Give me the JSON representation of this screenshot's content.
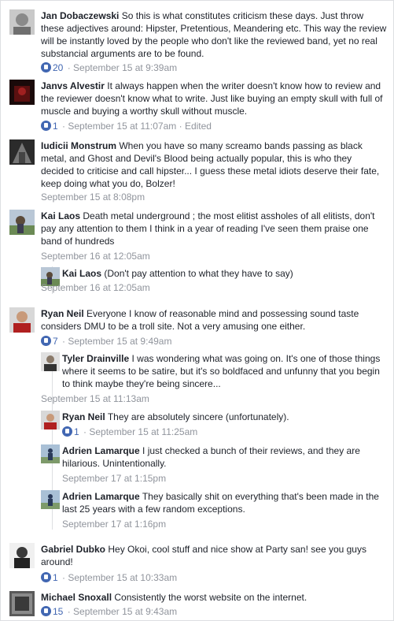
{
  "separator": "·",
  "comments": [
    {
      "author": "Jan Dobaczewski",
      "text": "So this is what constitutes criticism these days. Just throw these adjectives around: Hipster, Pretentious, Meandering etc. This way the review will be instantly loved by the people who don't like the reviewed band, yet no real substancial arguments are to be found.",
      "likes": "20",
      "time": "September 15 at 9:39am",
      "edited": ""
    },
    {
      "author": "Janvs Alvestir",
      "text": "It always happen when the writer doesn't know how to review and the reviewer doesn't know what to write. Just like buying an empty skull with full of muscle and buying a worthy skull without muscle.",
      "likes": "1",
      "time": "September 15 at 11:07am",
      "edited": "Edited"
    },
    {
      "author": "Iudicii Monstrum",
      "text": "When you have so many screamo bands passing as black metal, and Ghost and Devil's Blood being actually popular, this is who they decided to criticise and call hipster... I guess these metal idiots deserve their fate, keep doing what you do, Bolzer!",
      "likes": "",
      "time": "September 15 at 8:08pm",
      "edited": ""
    },
    {
      "author": "Kai Laos",
      "text": "Death metal underground ; the most elitist assholes of all elitists, don't pay any attention to them I think in a year of reading I've seen them praise one band of hundreds",
      "likes": "",
      "time": "September 16 at 12:05am",
      "edited": ""
    },
    {
      "author": "Kai Laos",
      "text": "(Don't pay attention to what they have to say)",
      "likes": "",
      "time": "September 16 at 12:05am",
      "edited": ""
    },
    {
      "author": "Ryan Neil",
      "text": "Everyone I know of reasonable mind and possessing sound taste considers DMU to be a troll site. Not a very amusing one either.",
      "likes": "7",
      "time": "September 15 at 9:49am",
      "edited": ""
    },
    {
      "author": "Tyler Drainville",
      "text": "I was wondering what was going on. It's one of those things where it seems to be satire, but it's so boldfaced and unfunny that you begin to think maybe they're being sincere...",
      "likes": "",
      "time": "September 15 at 11:13am",
      "edited": ""
    },
    {
      "author": "Ryan Neil",
      "text": "They are absolutely sincere (unfortunately).",
      "likes": "1",
      "time": "September 15 at 11:25am",
      "edited": ""
    },
    {
      "author": "Adrien Lamarque",
      "text": "I just checked a bunch of their reviews, and they are hilarious. Unintentionally.",
      "likes": "",
      "time": "September 17 at 1:15pm",
      "edited": ""
    },
    {
      "author": "Adrien Lamarque",
      "text": "They basically shit on everything that's been made in the last 25 years with a few random exceptions.",
      "likes": "",
      "time": "September 17 at 1:16pm",
      "edited": ""
    },
    {
      "author": "Gabriel Dubko",
      "text": "Hey Okoi, cool stuff and nice show at Party san! see you guys around!",
      "likes": "1",
      "time": "September 15 at 10:33am",
      "edited": ""
    },
    {
      "author": "Michael Snoxall",
      "text": "Consistently the worst website on the internet.",
      "likes": "15",
      "time": "September 15 at 9:43am",
      "edited": ""
    }
  ],
  "colors": {
    "link": "#4267b2",
    "meta": "#90949c",
    "text": "#1d2129",
    "divider": "#dddfe2"
  },
  "icons": [
    "like-icon",
    "avatar"
  ]
}
